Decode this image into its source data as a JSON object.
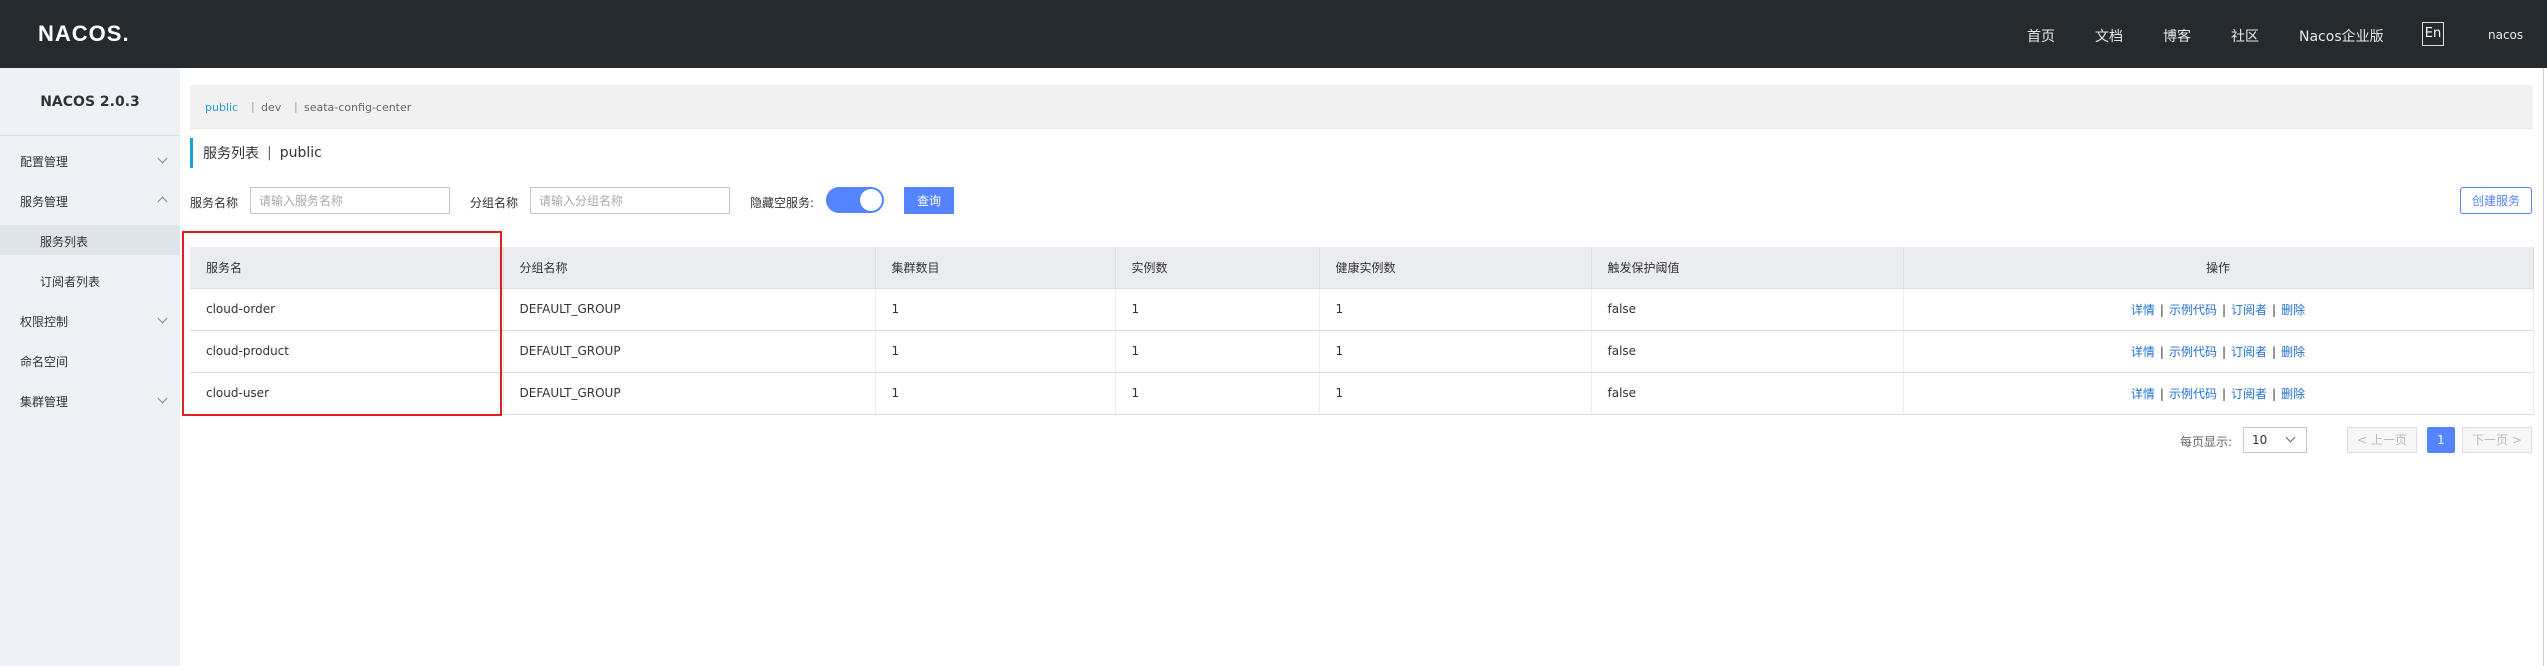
{
  "topbar": {
    "logo": "NACOS.",
    "nav": [
      "首页",
      "文档",
      "博客",
      "社区",
      "Nacos企业版"
    ],
    "lang": "En",
    "user": "nacos"
  },
  "sidebar": {
    "version": "NACOS 2.0.3",
    "items": [
      {
        "label": "配置管理",
        "chevron": "down"
      },
      {
        "label": "服务管理",
        "chevron": "up"
      },
      {
        "label": "服务列表",
        "sub": true,
        "active": true
      },
      {
        "label": "订阅者列表",
        "sub": true
      },
      {
        "label": "权限控制",
        "chevron": "down"
      },
      {
        "label": "命名空间"
      },
      {
        "label": "集群管理",
        "chevron": "down"
      }
    ]
  },
  "namespaces": {
    "items": [
      "public",
      "dev",
      "seata-config-center"
    ],
    "active": "public"
  },
  "page": {
    "title": "服务列表",
    "namespace": "public"
  },
  "search": {
    "service_label": "服务名称",
    "service_placeholder": "请输入服务名称",
    "group_label": "分组名称",
    "group_placeholder": "请输入分组名称",
    "hide_empty_label": "隐藏空服务:",
    "hide_empty_on": true,
    "query_button": "查询",
    "create_button": "创建服务"
  },
  "table": {
    "columns": [
      "服务名",
      "分组名称",
      "集群数目",
      "实例数",
      "健康实例数",
      "触发保护阈值",
      "操作"
    ],
    "rows": [
      {
        "name": "cloud-order",
        "group": "DEFAULT_GROUP",
        "clusters": "1",
        "instances": "1",
        "healthy": "1",
        "threshold": "false"
      },
      {
        "name": "cloud-product",
        "group": "DEFAULT_GROUP",
        "clusters": "1",
        "instances": "1",
        "healthy": "1",
        "threshold": "false"
      },
      {
        "name": "cloud-user",
        "group": "DEFAULT_GROUP",
        "clusters": "1",
        "instances": "1",
        "healthy": "1",
        "threshold": "false"
      }
    ],
    "ops": [
      "详情",
      "示例代码",
      "订阅者",
      "删除"
    ]
  },
  "pagination": {
    "per_page_label": "每页显示:",
    "per_page": "10",
    "prev": "上一页",
    "next": "下一页",
    "current": "1"
  },
  "colors": {
    "topbar": "#252a2f",
    "accent": "#5584ff",
    "link": "#1f6fd0",
    "highlight": "#e02020"
  }
}
